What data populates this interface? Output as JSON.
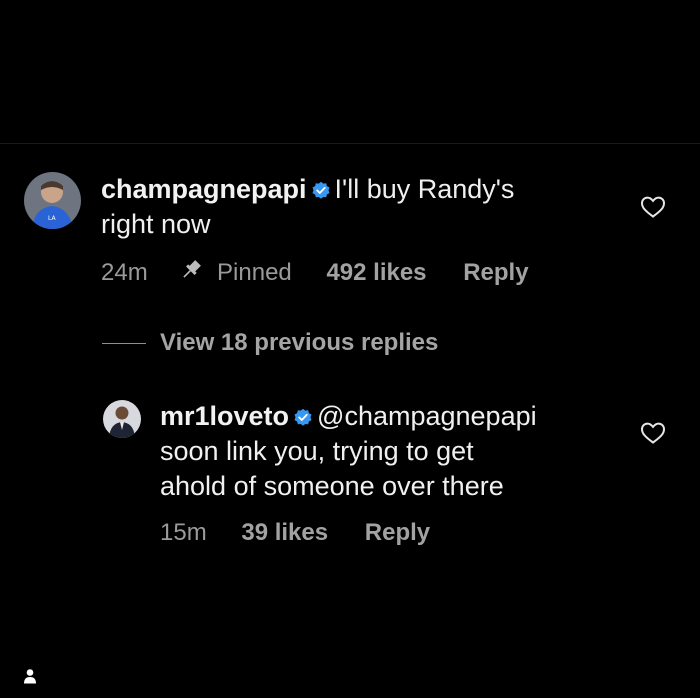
{
  "comments": [
    {
      "username": "champagnepapi",
      "text_line1": "I'll buy Randy's",
      "text_line2": "right now",
      "time": "24m",
      "pinned_label": "Pinned",
      "likes": "492 likes",
      "reply": "Reply"
    },
    {
      "username": "mr1loveto",
      "mention": "@champagnepapi",
      "text_line1": "soon link you, trying to get",
      "text_line2": "ahold of someone over there",
      "time": "15m",
      "likes": "39 likes",
      "reply": "Reply"
    }
  ],
  "view_replies": "View 18 previous replies",
  "colors": {
    "background": "#000000",
    "text": "#f0f0f0",
    "meta": "#9a9a9a",
    "verified": "#3897f0"
  },
  "icons": [
    "verified-badge-icon",
    "pin-icon",
    "heart-icon",
    "person-icon"
  ]
}
